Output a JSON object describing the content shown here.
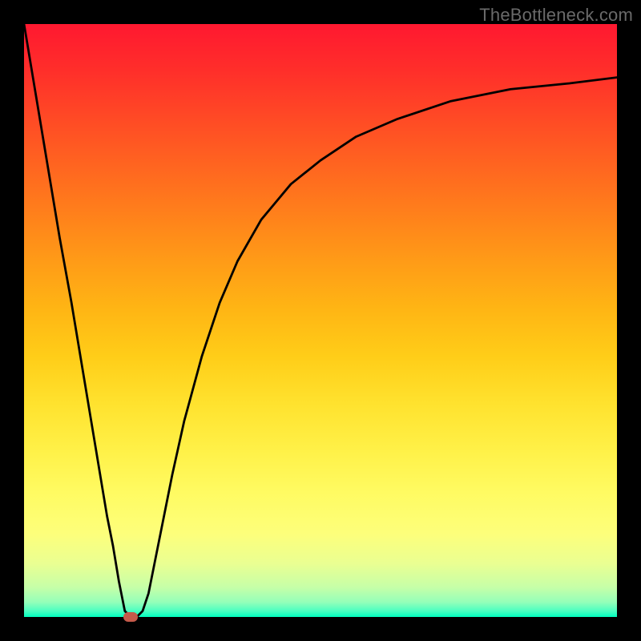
{
  "watermark": "TheBottleneck.com",
  "chart_data": {
    "type": "line",
    "title": "",
    "xlabel": "",
    "ylabel": "",
    "x_range": [
      0,
      100
    ],
    "y_range": [
      0,
      100
    ],
    "curve": {
      "x": [
        0,
        2,
        4,
        6,
        8,
        10,
        12,
        14,
        15,
        16,
        17,
        18,
        19,
        20,
        21,
        22,
        23,
        25,
        27,
        30,
        33,
        36,
        40,
        45,
        50,
        56,
        63,
        72,
        82,
        92,
        100
      ],
      "y": [
        100,
        88,
        76,
        64,
        53,
        41,
        29,
        17,
        12,
        6,
        1,
        0,
        0,
        1,
        4,
        9,
        14,
        24,
        33,
        44,
        53,
        60,
        67,
        73,
        77,
        81,
        84,
        87,
        89,
        90,
        91
      ]
    },
    "marker": {
      "x": 18,
      "y": 0,
      "color": "#c65a4a"
    },
    "colors": {
      "gradient_top": "#ff1830",
      "gradient_bottom": "#00ffbf",
      "curve": "#000000",
      "frame": "#000000"
    }
  }
}
